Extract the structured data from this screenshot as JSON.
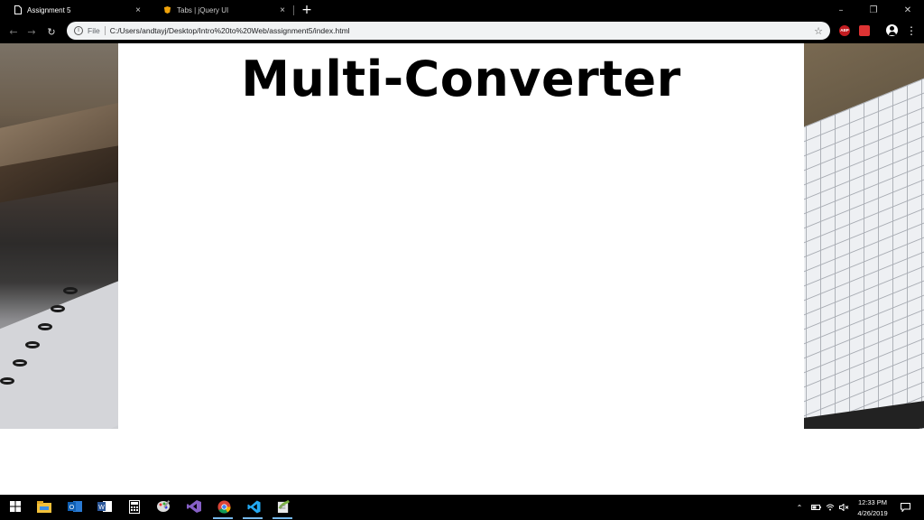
{
  "browser": {
    "tabs": [
      {
        "title": "Assignment 5",
        "active": true,
        "favicon": "page-icon"
      },
      {
        "title": "Tabs | jQuery UI",
        "active": false,
        "favicon": "jquery-icon"
      }
    ],
    "close_glyph": "×",
    "newtab_glyph": "+",
    "window_controls": {
      "minimize": "–",
      "maximize": "❐",
      "close": "✕"
    },
    "omnibox": {
      "scheme_label": "File",
      "url": "C:/Users/andtayj/Desktop/Intro%20to%20Web/assignment5/index.html"
    },
    "extensions": {
      "abp_label": "ABP"
    }
  },
  "page": {
    "title": "Multi-Converter"
  },
  "taskbar": {
    "apps": [
      "windows-start-icon",
      "file-explorer-icon",
      "outlook-icon",
      "word-icon",
      "calculator-icon",
      "paint-icon",
      "visual-studio-icon",
      "chrome-icon",
      "vscode-icon",
      "notepad-plus-icon"
    ],
    "clock": {
      "time": "12:33 PM",
      "date": "4/26/2019"
    }
  },
  "colors": {
    "chrome_dark": "#000000",
    "omnibox_bg": "#f1f3f4",
    "page_bg": "#ffffff",
    "taskbar_accent": "#76b9ed"
  }
}
